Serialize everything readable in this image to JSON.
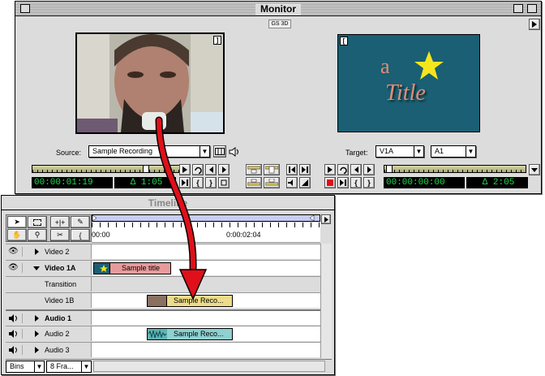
{
  "monitor": {
    "title": "Monitor",
    "mode_badge": "GS 3D",
    "source_label": "Source:",
    "source_value": "Sample Recording",
    "target_label": "Target:",
    "target_video": "V1A",
    "target_audio": "A1",
    "source_timecode": "00:00:01:19",
    "source_duration": "Δ 1:05",
    "program_timecode": "00:00:00:00",
    "program_duration": "Δ 2:05",
    "program_title_a": "a",
    "program_title_word": "Title"
  },
  "timeline": {
    "title": "Timeline",
    "ruler_start": "00:00",
    "ruler_mark": "0:00:02:04",
    "bins_label": "Bins",
    "zoom_label": "8 Fra...",
    "tracks": [
      {
        "name": "Video 2"
      },
      {
        "name": "Video 1A"
      },
      {
        "name": "Transition"
      },
      {
        "name": "Video 1B"
      },
      {
        "name": "Audio 1"
      },
      {
        "name": "Audio 2"
      },
      {
        "name": "Audio 3"
      }
    ],
    "clips": {
      "title_clip": "Sample title",
      "video_clip": "Sample Reco...",
      "audio_clip": "Sample Reco..."
    }
  },
  "colors": {
    "timecode_green": "#1fdc4d",
    "program_bg": "#1a5f73",
    "title_clip": "#e89a9a",
    "video_clip": "#eedc8a",
    "audio_clip": "#8fd0d0",
    "drag_arrow": "#e0101a"
  }
}
